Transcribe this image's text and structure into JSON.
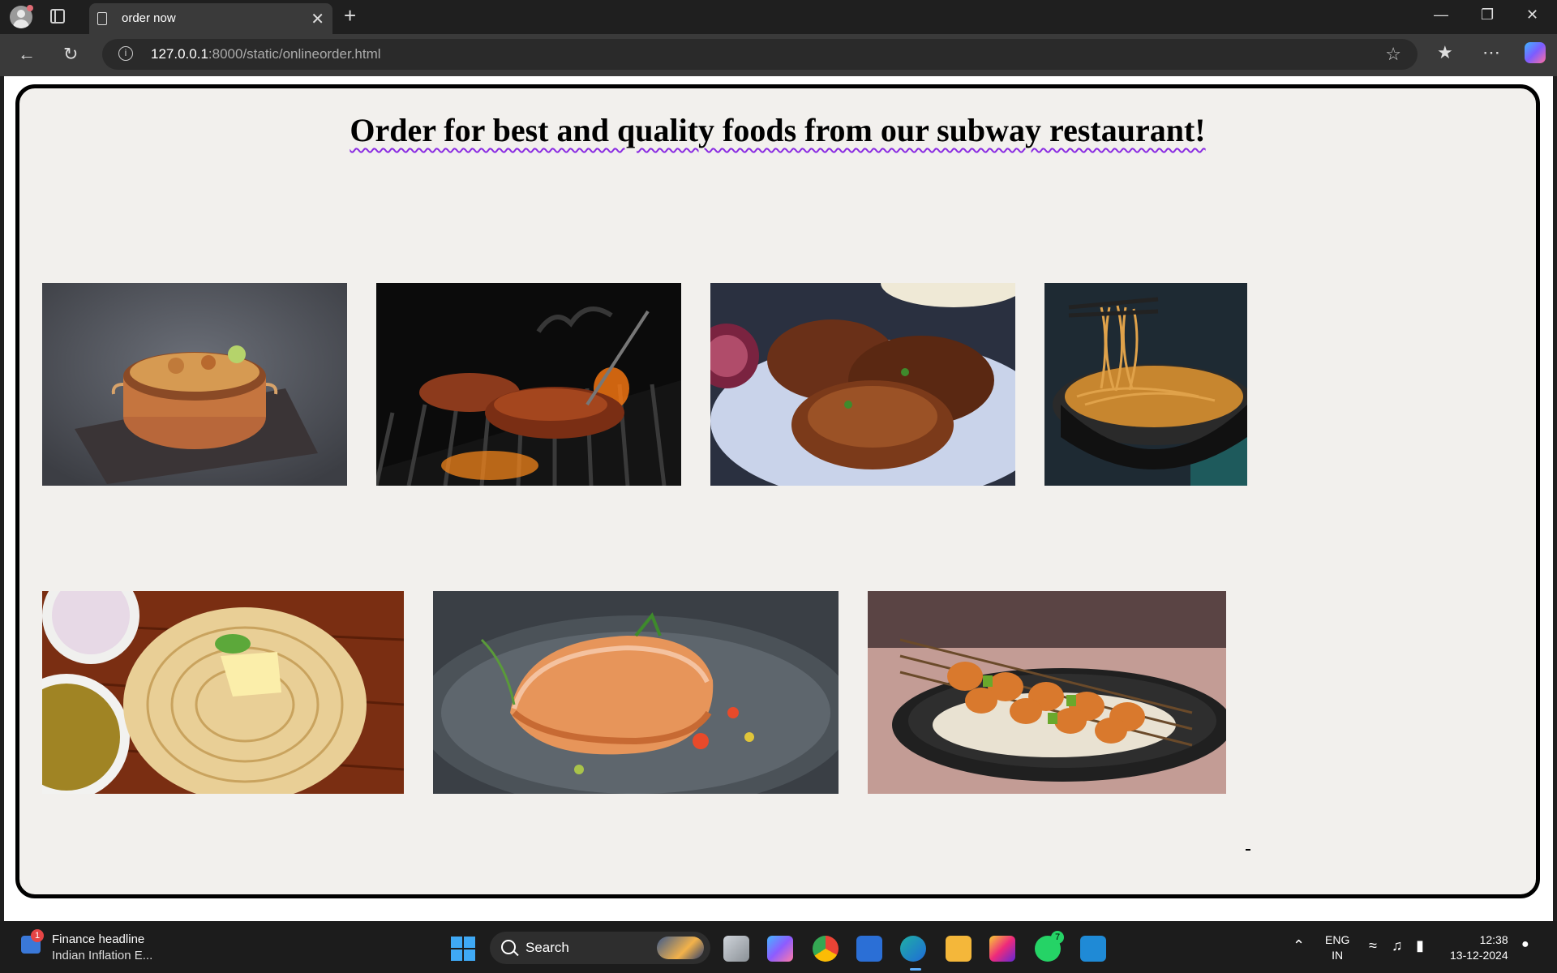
{
  "browser": {
    "tab_title": "order now",
    "url_host": "127.0.0.1",
    "url_rest": ":8000/static/onlineorder.html",
    "new_tab_glyph": "+",
    "close_glyph": "✕"
  },
  "page": {
    "heading": "Order for best and quality foods from our subway restaurant!",
    "images": [
      {
        "name": "biryani-image",
        "icon": "biryani-copper-pot"
      },
      {
        "name": "grilled-steak-image",
        "icon": "steak-on-grill"
      },
      {
        "name": "fried-fish-image",
        "icon": "fried-fish-plate"
      },
      {
        "name": "noodles-image",
        "icon": "noodles-bowl"
      },
      {
        "name": "parotta-image",
        "icon": "parotta-with-butter"
      },
      {
        "name": "salmon-image",
        "icon": "salmon-fillet-plate"
      },
      {
        "name": "chicken-skewers-image",
        "icon": "chicken-skewers-rice"
      }
    ]
  },
  "taskbar": {
    "news_title": "Finance headline",
    "news_sub": "Indian Inflation E...",
    "news_badge": "1",
    "search_label": "Search",
    "whatsapp_badge": "7",
    "lang_line1": "ENG",
    "lang_line2": "IN",
    "time": "12:38",
    "date": "13-12-2024"
  }
}
